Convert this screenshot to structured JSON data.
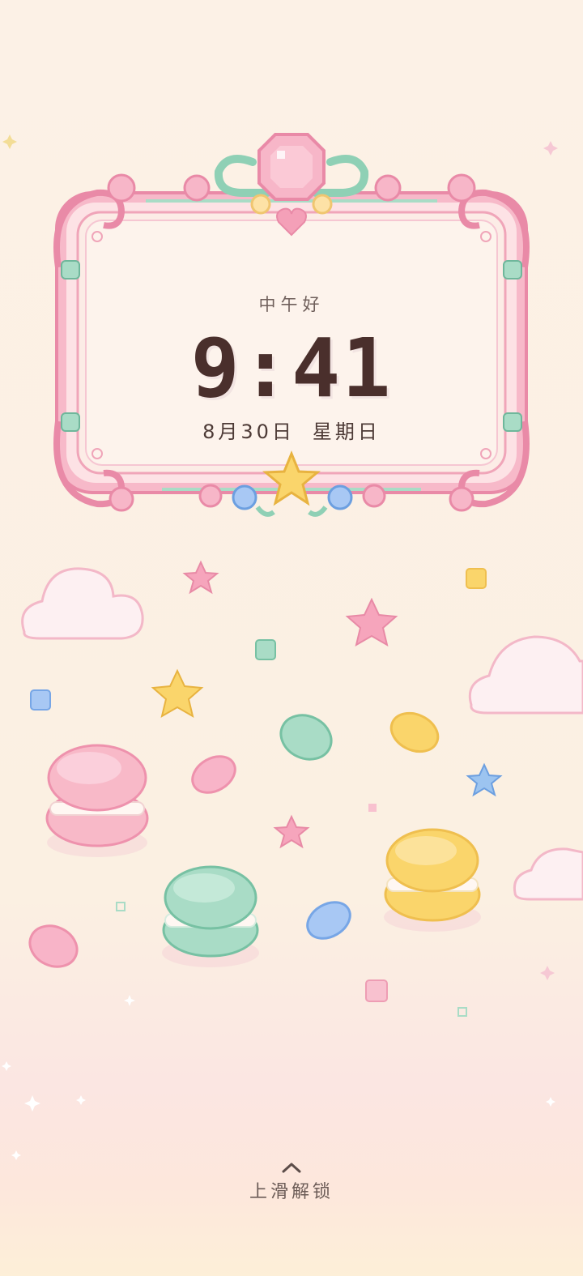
{
  "lockscreen": {
    "greeting": "中午好",
    "time": "9:41",
    "date": "8月30日",
    "weekday": "星期日",
    "unlock_hint": "上滑解锁",
    "unlock_icon": "chevron-up-icon"
  },
  "colors": {
    "frame_pink": "#f4a9bf",
    "frame_inner": "#fdeee8",
    "mint": "#a9dcc6",
    "gem": "#f7b6c8",
    "star_yellow": "#fad56b",
    "star_pink": "#f6a5bc",
    "sky_blue": "#9cc4f0",
    "text_dark": "#4a2f2c",
    "background": "#fcf1e6"
  }
}
